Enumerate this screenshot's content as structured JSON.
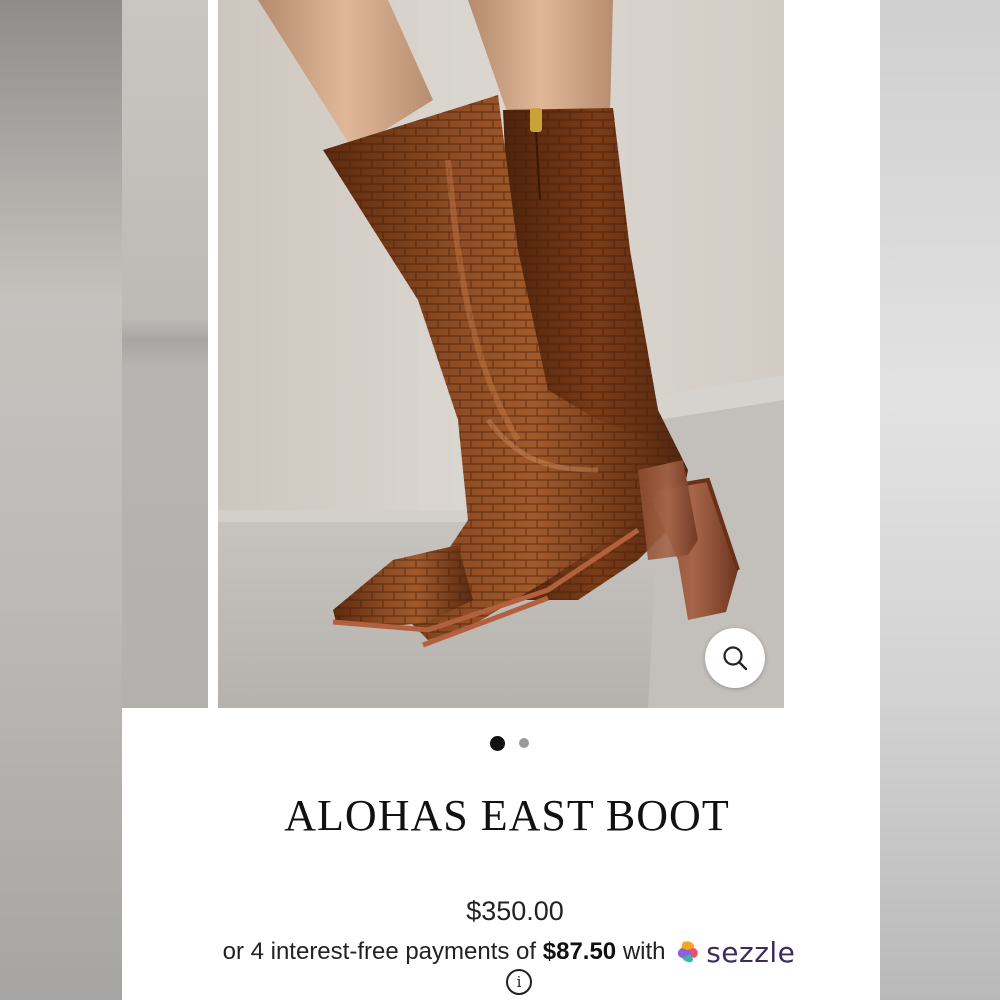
{
  "product": {
    "title": "ALOHAS EAST BOOT",
    "price": "$350.00"
  },
  "payment": {
    "prefix": "or 4 interest-free payments of",
    "amount": "$87.50",
    "middle": "with",
    "provider": "sezzle",
    "info_glyph": "i"
  },
  "gallery": {
    "total_images": 2,
    "active_index": 1,
    "zoom_icon": "magnifier-icon"
  },
  "colors": {
    "boot_leather": "#7a3a16",
    "title_text": "#111111",
    "sezzle_purple": "#3b2c5a",
    "active_dot": "#111111",
    "inactive_dot": "#9a9a9a"
  }
}
